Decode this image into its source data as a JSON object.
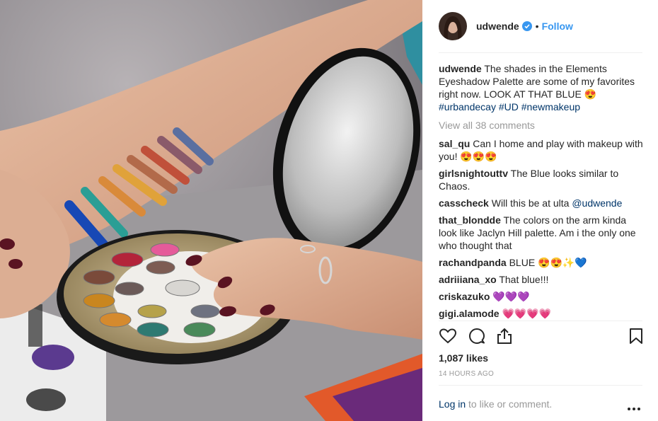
{
  "post": {
    "username": "udwende",
    "follow_label": "Follow",
    "separator": "•"
  },
  "caption": {
    "username": "udwende",
    "text": "The shades in the Elements Eyeshadow Palette are some of my favorites right now. LOOK AT THAT BLUE 😍",
    "hashtags": [
      "#urbandecay",
      "#UD",
      "#newmakeup"
    ]
  },
  "view_all": "View all 38 comments",
  "comments": [
    {
      "user": "sal_qu",
      "text": "Can I home and play with makeup with you! 😍😍😍"
    },
    {
      "user": "girlsnightouttv",
      "text": "The Blue looks similar to Chaos."
    },
    {
      "user": "casscheck",
      "text": "Will this be at ulta",
      "mention": "@udwende"
    },
    {
      "user": "that_blondde",
      "text": "The colors on the arm kinda look like Jaclyn Hill palette. Am i the only one who thought that"
    },
    {
      "user": "rachandpanda",
      "text": "BLUE 😍😍✨💙"
    },
    {
      "user": "adriiiana_xo",
      "text": "That blue!!!"
    },
    {
      "user": "criskazuko",
      "text": "💜💜💜"
    },
    {
      "user": "gigi.alamode",
      "text": "💗💗💗💗"
    }
  ],
  "likes": "1,087 likes",
  "timestamp": "14 HOURS AGO",
  "login": {
    "link": "Log in",
    "rest": " to like or comment."
  },
  "icons": {
    "like": "heart-icon",
    "comment": "comment-icon",
    "share": "share-icon",
    "save": "bookmark-icon",
    "more": "more-options-icon",
    "verified": "verified-badge-icon"
  },
  "colors": {
    "link": "#3897f0",
    "hashtag": "#003569",
    "muted": "#999999"
  }
}
